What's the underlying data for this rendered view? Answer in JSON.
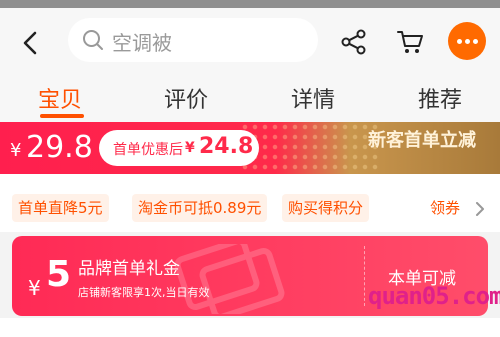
{
  "search": {
    "placeholder": "空调被"
  },
  "icons": {
    "back": "chevron-left-icon",
    "search": "search-icon",
    "share": "share-icon",
    "cart": "cart-icon",
    "more": "more-icon"
  },
  "colors": {
    "accent": "#ff5000",
    "price_band": "#ff2a4a",
    "coupon": "#ff2a55",
    "more_button": "#ff6a00"
  },
  "tabs": [
    {
      "label": "宝贝",
      "active": true
    },
    {
      "label": "评价",
      "active": false
    },
    {
      "label": "详情",
      "active": false
    },
    {
      "label": "推荐",
      "active": false
    }
  ],
  "price": {
    "currency": "¥",
    "current": "29.8",
    "after_label": "首单优惠后",
    "after_currency": "¥",
    "after_price": "24.8",
    "promo_title": "新客首单立减"
  },
  "benefits": {
    "chips": [
      "首单直降5元",
      "淘金币可抵0.89元",
      "购买得积分"
    ],
    "coupon_link": "领券"
  },
  "coupon": {
    "currency": "¥",
    "amount": "5",
    "title": "品牌首单礼金",
    "subtitle": "店铺新客限享1次,当日有效",
    "action": "本单可减"
  },
  "watermark": "quan05.com"
}
